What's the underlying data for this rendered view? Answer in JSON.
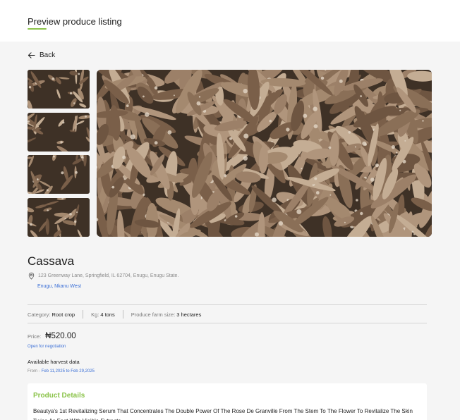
{
  "header": {
    "title": "Preview produce listing"
  },
  "nav": {
    "back_label": "Back",
    "back_icon": "arrow-left-icon"
  },
  "gallery": {
    "thumbnail_count": 4,
    "image_subject": "cassava roots"
  },
  "product": {
    "name": "Cassava",
    "address": "123 Greenway Lane, Springfield, IL 62704, Enugu, Enugu State.",
    "area": "Enugu, Nkanu West",
    "location_icon": "map-pin-icon"
  },
  "specs": {
    "category_label": "Category:",
    "category_value": "Root crop",
    "kg_label": "Kg:",
    "kg_value": "4 tons",
    "farm_size_label": "Produce farm size:",
    "farm_size_value": "3 hectares"
  },
  "pricing": {
    "label": "Price:",
    "value": "₦520.00",
    "negotiation": "Open for negotiation"
  },
  "harvest": {
    "title": "Available harvest data",
    "from_label": "From -",
    "range": "Feb 11,2025 to Feb 29,2025"
  },
  "details": {
    "title": "Product Details",
    "body": "Beautya's 1st Revitalizing Serum That Concentrates The Double Power Of The Rose De Granville From The Stem To The Flower To Revitalize The Skin Twice As Fast With Visible Extracts"
  },
  "colors": {
    "accent_green": "#8bc34a",
    "link_blue": "#3b6fd6",
    "page_bg": "#f5f5f5"
  }
}
